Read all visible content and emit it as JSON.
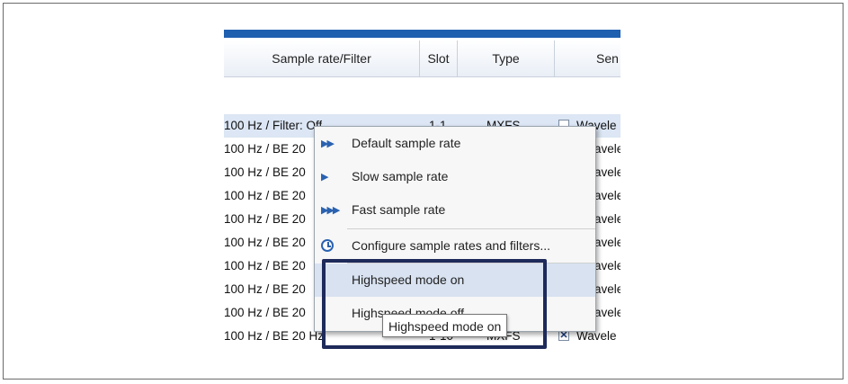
{
  "columns": [
    "Sample rate/Filter",
    "Slot",
    "Type",
    "Sen"
  ],
  "rows": [
    {
      "rate": "100 Hz / Filter: Off",
      "slot": "1-1",
      "type": "MXFS",
      "sensor": "Wavele",
      "checked": false
    },
    {
      "rate": "100 Hz / BE 20",
      "sensor": "avele"
    },
    {
      "rate": "100 Hz / BE 20",
      "sensor": "avele"
    },
    {
      "rate": "100 Hz / BE 20",
      "sensor": "avele"
    },
    {
      "rate": "100 Hz / BE 20",
      "sensor": "avele"
    },
    {
      "rate": "100 Hz / BE 20",
      "sensor": "avele"
    },
    {
      "rate": "100 Hz / BE 20",
      "sensor": "avele"
    },
    {
      "rate": "100 Hz / BE 20",
      "sensor": "avele"
    },
    {
      "rate": "100 Hz / BE 20",
      "sensor": "avele"
    },
    {
      "rate": "100 Hz / BE 20 Hz",
      "slot": "1-10",
      "type": "MXFS",
      "sensor": "Wavele",
      "checked": true
    }
  ],
  "context_menu": {
    "items": [
      {
        "label": "Default sample rate",
        "icon": "double-arrow-icon",
        "glyph": "▶▶"
      },
      {
        "label": "Slow sample rate",
        "icon": "single-arrow-icon",
        "glyph": "▶"
      },
      {
        "label": "Fast sample rate",
        "icon": "triple-arrow-icon",
        "glyph": "▶▶▶"
      },
      {
        "label": "Configure sample rates and filters...",
        "icon": "clock-icon"
      },
      {
        "label": "Highspeed mode on",
        "highlighted": true
      },
      {
        "label": "Highspeed mode off"
      }
    ]
  },
  "tooltip": {
    "text": "Highspeed mode on"
  },
  "colors": {
    "accent": "#1f5fb0",
    "highlight_border": "#1e2a5a",
    "selection": "#dce6f4"
  }
}
